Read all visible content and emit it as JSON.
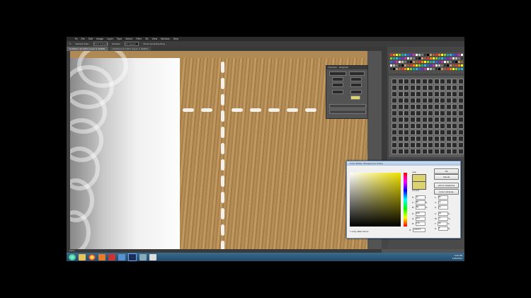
{
  "menu": [
    "Ps",
    "File",
    "Edit",
    "Image",
    "Layer",
    "Type",
    "Select",
    "Filter",
    "3D",
    "View",
    "Window",
    "Help"
  ],
  "options_bar": {
    "sample_size_label": "Sample Size:",
    "sample_size_value": "Point Sample",
    "sample_label": "Sample:",
    "sample_value": "All Layers",
    "show_ring": "Show Sampling Ring"
  },
  "doc_tabs": [
    "Untitled-1 @ 100% (Layer 0, RGB/8)",
    "Untitled-2 @ 100% (Layer 1, RGB/8)"
  ],
  "char_panel": {
    "tab1": "Character",
    "tab2": "Paragraph"
  },
  "picker": {
    "title": "Color Picker (Foreground Color)",
    "ok": "OK",
    "cancel": "Cancel",
    "add_swatches": "Add to Swatches",
    "libraries": "Color Libraries",
    "new_label": "new",
    "current_label": "current",
    "only_web": "Only Web Colors",
    "H": "57",
    "S": "48",
    "B": "86",
    "R": "220",
    "G": "211",
    "Bv": "115",
    "L": "83",
    "a": "-6",
    "b": "41",
    "C": "16",
    "M": "9",
    "Y": "68",
    "K": "0",
    "hex": "ddd373"
  },
  "status": "100%",
  "layers": [
    "Effects",
    "Drop Shadow"
  ],
  "clock": {
    "time": "2:00 PM",
    "date": "1/26/2014"
  },
  "colors": {
    "picked": "#ddd373"
  }
}
